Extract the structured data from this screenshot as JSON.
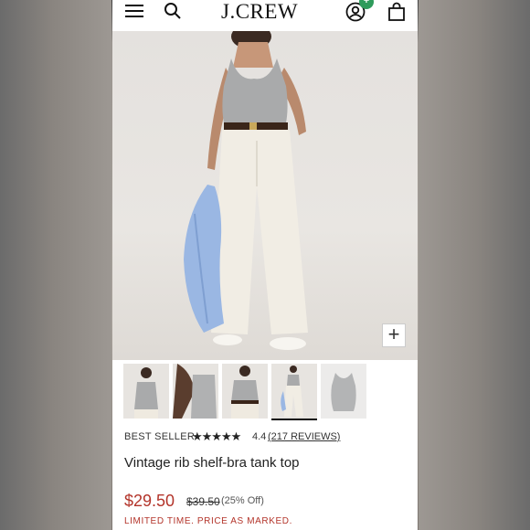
{
  "header": {
    "logo": "J.CREW",
    "cart_badge": "+"
  },
  "hero": {
    "zoom_label": "+"
  },
  "product": {
    "badge": "BEST SELLER",
    "rating": 4.4,
    "rating_text": "4.4",
    "stars": "★★★★★",
    "reviews": "(217 REVIEWS)",
    "name": "Vintage rib shelf-bra tank top",
    "price": "$29.50",
    "original_price": "$39.50",
    "discount": "(25% Off)",
    "promo_note": "LIMITED TIME. PRICE AS MARKED."
  },
  "thumbnails": [
    {
      "label": "front-view"
    },
    {
      "label": "back-view"
    },
    {
      "label": "back-detail"
    },
    {
      "label": "full-length",
      "active": true
    },
    {
      "label": "flat-lay"
    }
  ],
  "colors": {
    "sale": "#b3342a",
    "badge": "#2e9b5b"
  }
}
